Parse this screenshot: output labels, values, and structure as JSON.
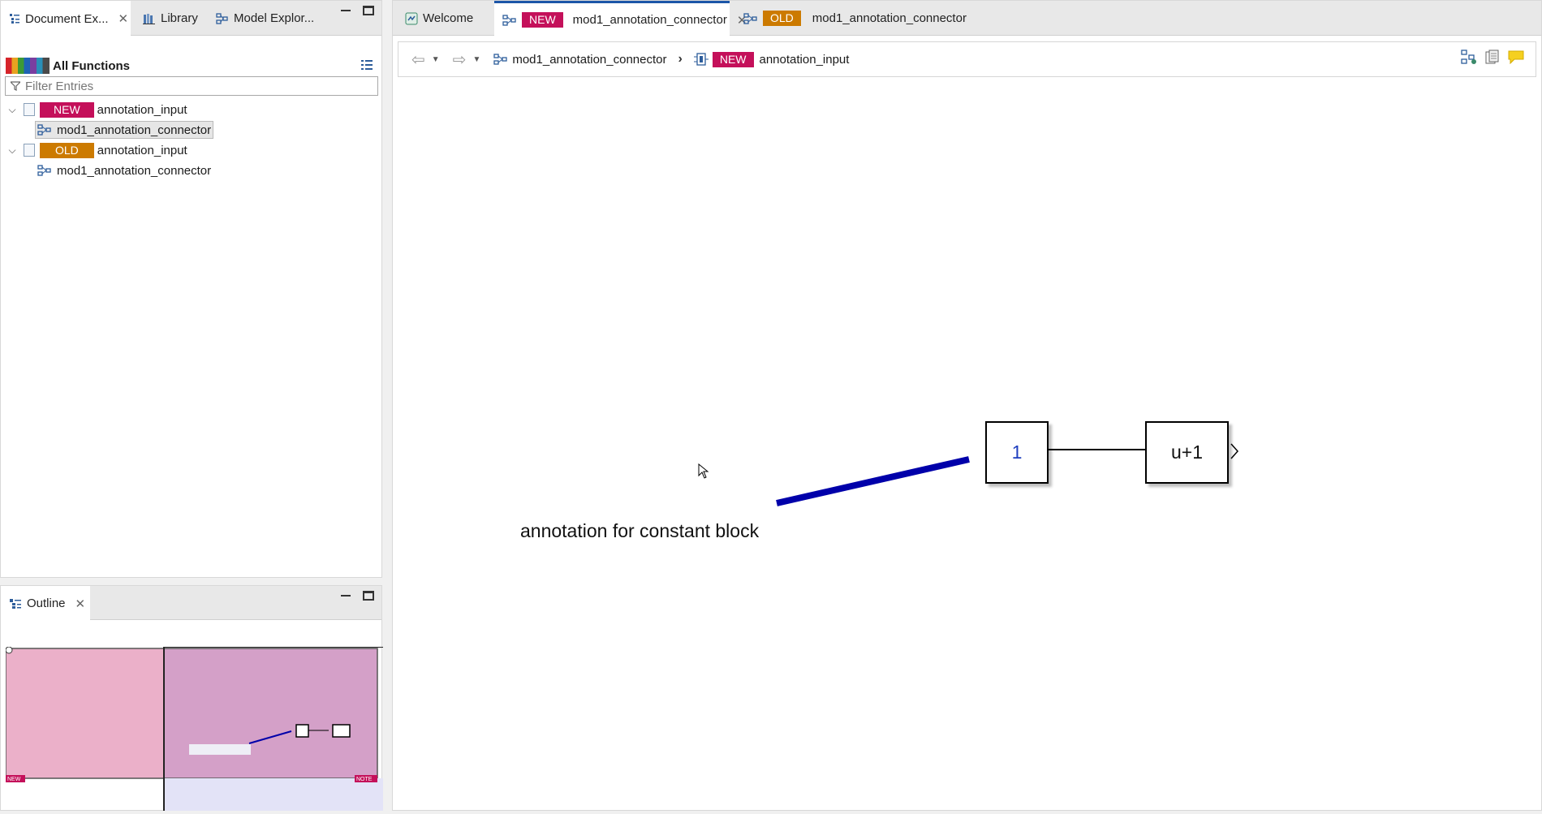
{
  "left_tabs": [
    {
      "label": "Document Ex...",
      "icon": "document-explorer-icon",
      "active": true
    },
    {
      "label": "Library",
      "icon": "library-icon"
    },
    {
      "label": "Model Explor...",
      "icon": "model-explorer-icon"
    }
  ],
  "functions": {
    "title": "All Functions",
    "filter_placeholder": "Filter Entries"
  },
  "tree": [
    {
      "tag": "NEW",
      "label": "annotation_input",
      "expanded": true,
      "children": [
        "mod1_annotation_connector"
      ]
    },
    {
      "tag": "OLD",
      "label": "annotation_input",
      "expanded": true,
      "children": [
        "mod1_annotation_connector"
      ]
    }
  ],
  "outline": {
    "tab_label": "Outline",
    "new_tag": "NEW",
    "other_tag": "NOTE"
  },
  "editor_tabs": [
    {
      "label": "Welcome",
      "icon": "welcome-icon"
    },
    {
      "tag": "NEW",
      "label": "mod1_annotation_connector",
      "active": true
    },
    {
      "tag": "OLD",
      "label": "mod1_annotation_connector"
    }
  ],
  "breadcrumb": [
    {
      "label": "mod1_annotation_connector"
    },
    {
      "tag": "NEW",
      "label": "annotation_input"
    }
  ],
  "diagram": {
    "constant_value": "1",
    "function_label": "u+1",
    "annotation": "annotation for constant block"
  },
  "colors": {
    "new_tag": "#c4105a",
    "old_tag": "#cc7a00",
    "annotation_line": "#0000aa",
    "outline_left": "#ebb0c9",
    "outline_right": "#d4a0c8",
    "active_tab_accent": "#1c56a8"
  }
}
